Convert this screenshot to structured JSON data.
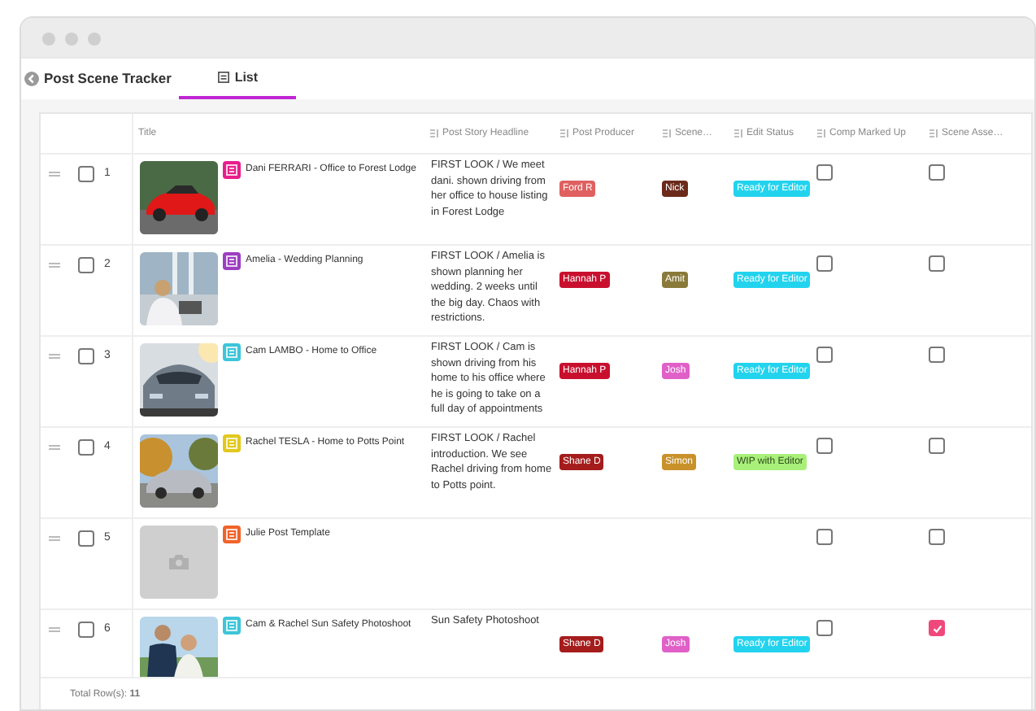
{
  "window": {
    "title": "Post Scene Tracker"
  },
  "tabs": [
    {
      "label": "List",
      "selected": true
    }
  ],
  "table": {
    "columns": [
      {
        "label": "Title",
        "kind": "plain"
      },
      {
        "label": "Post Story Headline",
        "kind": "field"
      },
      {
        "label": "Post Producer",
        "kind": "field"
      },
      {
        "label": "Scene…",
        "kind": "field"
      },
      {
        "label": "Edit Status",
        "kind": "field"
      },
      {
        "label": "Comp Marked Up",
        "kind": "field"
      },
      {
        "label": "Scene Asse…",
        "kind": "field"
      }
    ],
    "rows": [
      {
        "number": "1",
        "selected": false,
        "icon": {
          "color": "#e91e8c"
        },
        "title": "Dani FERRARI - Office to Forest Lodge",
        "headline": "FIRST LOOK / We meet dani. shown driving from her office to house listing in Forest Lodge",
        "producer": {
          "text": "Ford R",
          "color": "#e06060"
        },
        "scene": {
          "text": "Nick",
          "color": "#6b2a1a"
        },
        "edit_status": {
          "text": "Ready for Editor",
          "color": "#22d3ee"
        },
        "comp_marked_up": false,
        "scene_asse": false
      },
      {
        "number": "2",
        "selected": false,
        "icon": {
          "color": "#9c3fc0"
        },
        "title": "Amelia - Wedding Planning",
        "headline": "FIRST LOOK / Amelia is shown planning her wedding. 2 weeks until the big day. Chaos with restrictions.",
        "producer": {
          "text": "Hannah P",
          "color": "#c8102e"
        },
        "scene": {
          "text": "Amit",
          "color": "#8a7a3a"
        },
        "edit_status": {
          "text": "Ready for Editor",
          "color": "#22d3ee"
        },
        "comp_marked_up": false,
        "scene_asse": false
      },
      {
        "number": "3",
        "selected": false,
        "icon": {
          "color": "#3ec5d8"
        },
        "title": "Cam LAMBO - Home to Office",
        "headline": "FIRST LOOK / Cam is shown driving from his home to his office where he is going to take on a full day of appointments",
        "producer": {
          "text": "Hannah P",
          "color": "#c8102e"
        },
        "scene": {
          "text": "Josh",
          "color": "#e060c8"
        },
        "edit_status": {
          "text": "Ready for Editor",
          "color": "#22d3ee"
        },
        "comp_marked_up": false,
        "scene_asse": false
      },
      {
        "number": "4",
        "selected": false,
        "icon": {
          "color": "#e2c81c"
        },
        "title": "Rachel TESLA - Home to Potts Point",
        "headline": "FIRST LOOK / Rachel introduction. We see Rachel driving from home to Potts point.",
        "producer": {
          "text": "Shane D",
          "color": "#a51c1c"
        },
        "scene": {
          "text": "Simon",
          "color": "#c8912a"
        },
        "edit_status": {
          "text": "WIP with Editor",
          "color": "#a8f07a"
        },
        "comp_marked_up": false,
        "scene_asse": false
      },
      {
        "number": "5",
        "selected": false,
        "thumbnail": {
          "kind": "placeholder"
        },
        "icon": {
          "color": "#f0632a"
        },
        "title": "Julie Post Template",
        "comp_marked_up": false,
        "scene_asse": false
      },
      {
        "number": "6",
        "selected": false,
        "icon": {
          "color": "#3ec5d8"
        },
        "title": "Cam & Rachel Sun Safety Photoshoot",
        "headline": "Sun Safety Photoshoot",
        "producer": {
          "text": "Shane D",
          "color": "#a51c1c"
        },
        "scene": {
          "text": "Josh",
          "color": "#e060c8"
        },
        "edit_status": {
          "text": "Ready for Editor",
          "color": "#22d3ee"
        },
        "comp_marked_up": false,
        "scene_asse": true
      }
    ]
  },
  "footer": {
    "total": "Total Row(s): **11**"
  }
}
